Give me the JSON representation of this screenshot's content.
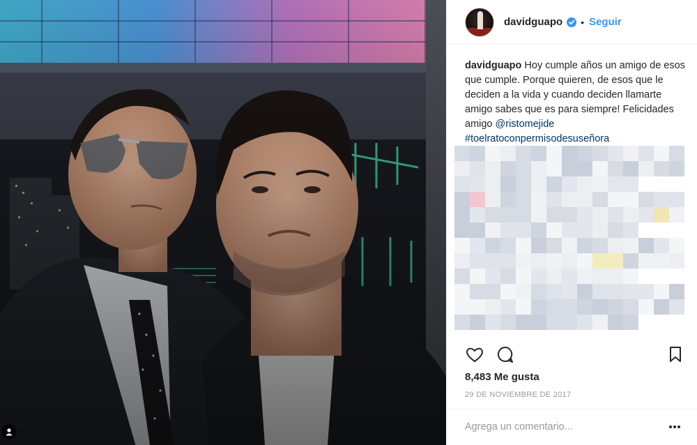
{
  "post": {
    "username": "davidguapo",
    "follow_label": "Seguir",
    "separator": "•",
    "caption_user": "davidguapo",
    "caption_text": "Hoy cumple años un amigo de esos que cumple. Porque quieren, de esos que le deciden a la vida y cuando deciden llamarte amigo sabes que es para siempre! Felicidades amigo ",
    "caption_mention": "@ristomejide",
    "caption_hashtag": "#toelratoconpermisodesuseñora",
    "likes": "8,483 Me gusta",
    "date": "29 DE NOVIEMBRE DE 2017",
    "comment_placeholder": "Agrega un comentario..."
  },
  "icons": {
    "verified": "verified-badge-icon",
    "like": "heart-icon",
    "comment": "comment-icon",
    "save": "bookmark-icon",
    "more": "more-options-icon",
    "user_tag": "user-tag-icon"
  },
  "colors": {
    "link_blue": "#3897f0",
    "hashtag_blue": "#003569",
    "muted": "#999999",
    "text": "#262626"
  }
}
